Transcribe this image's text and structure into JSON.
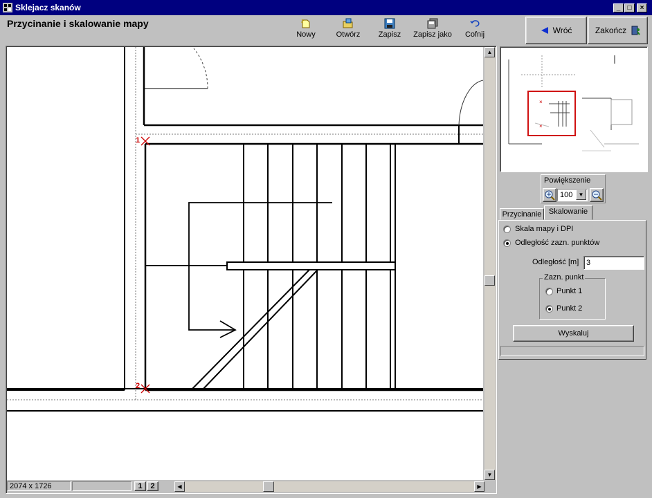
{
  "window": {
    "title": "Sklejacz skanów"
  },
  "header": {
    "title": "Przycinanie i skalowanie mapy"
  },
  "toolbar": {
    "new_label": "Nowy",
    "open_label": "Otwórz",
    "save_label": "Zapisz",
    "save_as_label": "Zapisz jako",
    "undo_label": "Cofnij"
  },
  "nav": {
    "back_label": "Wróć",
    "finish_label": "Zakończ"
  },
  "map": {
    "point1_label": "1",
    "point2_label": "2"
  },
  "status": {
    "dimensions": "2074 x 1726",
    "page1": "1",
    "page2": "2"
  },
  "zoom": {
    "group_label": "Powiększenie",
    "value": "100"
  },
  "tabs": [
    {
      "label": "Przycinanie"
    },
    {
      "label": "Skalowanie"
    }
  ],
  "scaling": {
    "option_scale_dpi": "Skala mapy i DPI",
    "option_distance": "Odległość zazn. punktów",
    "distance_label": "Odległość [m]",
    "distance_value": "3",
    "points_group_label": "Zazn. punkt",
    "point1_option": "Punkt 1",
    "point2_option": "Punkt 2",
    "compute_button": "Wyskaluj"
  },
  "colors": {
    "titlebar": "#00007f",
    "marker": "#cc0000",
    "preview_frame": "#d01010"
  }
}
